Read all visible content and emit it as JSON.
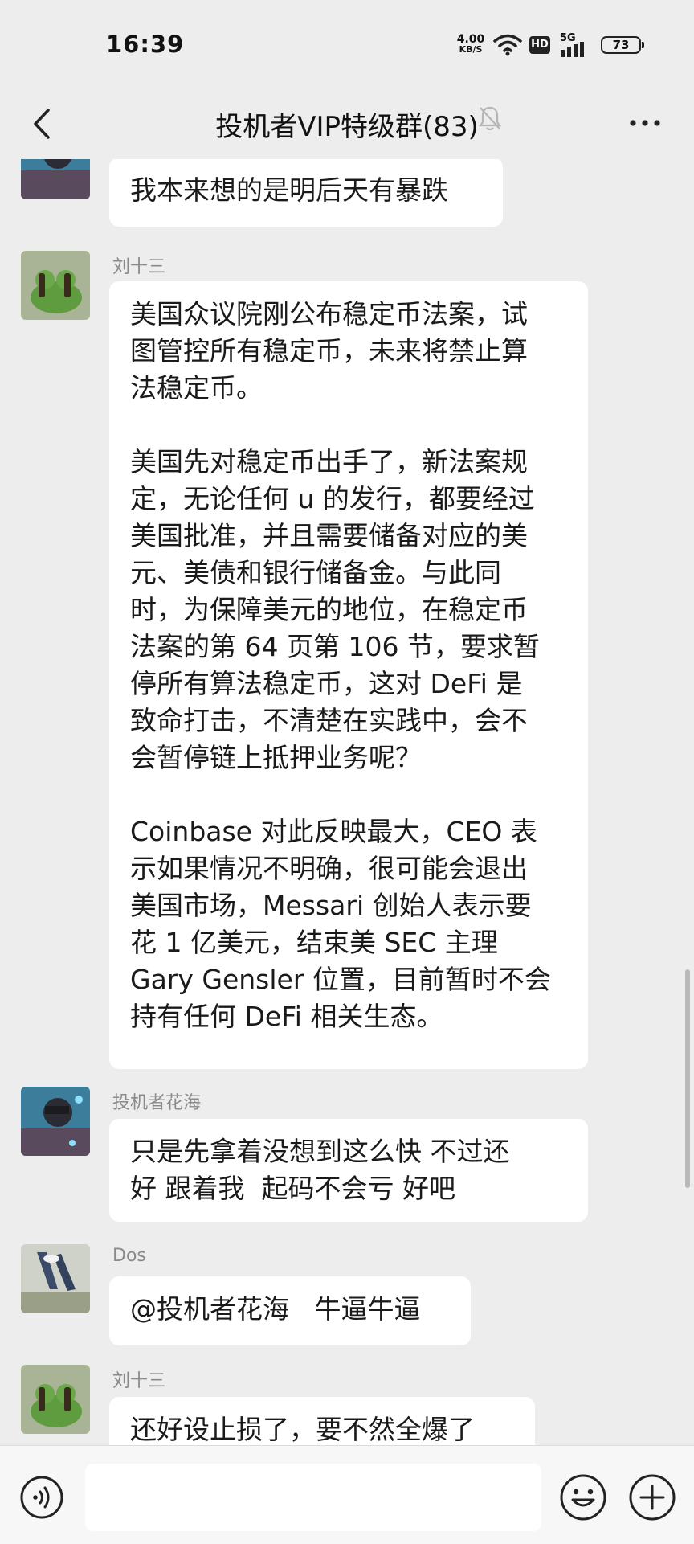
{
  "status": {
    "time": "16:39",
    "net_speed_value": "4.00",
    "net_speed_unit": "KB/S",
    "hd": "HD",
    "net_type": "5G",
    "battery": "73"
  },
  "header": {
    "title": "投机者VIP特级群(83)"
  },
  "messages": [
    {
      "sender": "",
      "text": "我本来想的是明后天有暴跌"
    },
    {
      "sender": "刘十三",
      "text": "美国众议院刚公布稳定币法案，试\n图管控所有稳定币，未来将禁止算\n法稳定币。\n\n美国先对稳定币出手了，新法案规\n定，无论任何 u 的发行，都要经过\n美国批准，并且需要储备对应的美\n元、美债和银行储备金。与此同\n时，为保障美元的地位，在稳定币\n法案的第 64 页第 106 节，要求暂\n停所有算法稳定币，这对 DeFi 是\n致命打击，不清楚在实践中，会不\n会暂停链上抵押业务呢？\n\nCoinbase 对此反映最大，CEO 表\n示如果情况不明确，很可能会退出\n美国市场，Messari 创始人表示要\n花 1 亿美元，结束美 SEC 主理\nGary Gensler 位置，目前暂时不会\n持有任何 DeFi 相关生态。"
    },
    {
      "sender": "投机者花海",
      "text": "只是先拿着没想到这么快 不过还\n好 跟着我  起码不会亏 好吧"
    },
    {
      "sender": "Dos",
      "text": "@投机者花海   牛逼牛逼"
    },
    {
      "sender": "刘十三",
      "text": "还好设止损了，要不然全爆了"
    }
  ],
  "icons": [
    "back-arrow-icon",
    "wifi-icon",
    "signal-icon",
    "battery-icon",
    "mute-bell-icon",
    "more-dots-icon",
    "voice-icon",
    "emoji-icon",
    "plus-icon"
  ],
  "colors": {
    "background": "#ededed",
    "bubble": "#ffffff",
    "sender_name": "#8a8a8a",
    "input_bar": "#f7f7f7"
  }
}
